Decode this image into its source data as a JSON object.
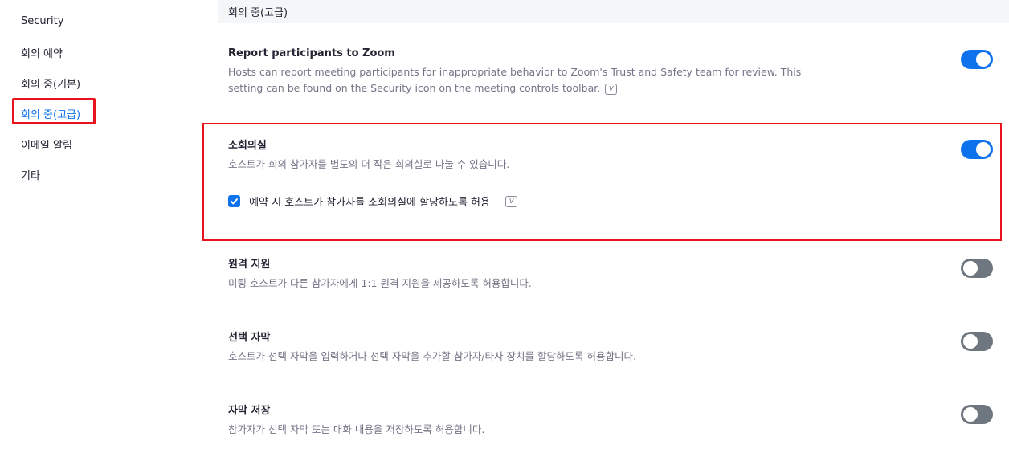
{
  "sidebar": {
    "items": [
      {
        "label": "Security"
      },
      {
        "label": "회의 예약"
      },
      {
        "label": "회의 중(기본)"
      },
      {
        "label": "회의 중(고급)"
      },
      {
        "label": "이메일 알림"
      },
      {
        "label": "기타"
      }
    ],
    "active_index": 3
  },
  "section": {
    "title": "회의 중(고급)"
  },
  "settings": [
    {
      "title": "Report participants to Zoom",
      "description": "Hosts can report meeting participants for inappropriate behavior to Zoom's Trust and Safety team for review. This setting can be found on the Security icon on the meeting controls toolbar.",
      "enabled": true
    },
    {
      "title": "소회의실",
      "description": "호스트가 회의 참가자를 별도의 더 작은 회의실로 나눌 수 있습니다.",
      "enabled": true,
      "checkbox": {
        "label": "예약 시 호스트가 참가자를 소회의실에 할당하도록 허용",
        "checked": true
      }
    },
    {
      "title": "원격 지원",
      "description": "미팅 호스트가 다른 참가자에게 1:1 원격 지원을 제공하도록 허용합니다.",
      "enabled": false
    },
    {
      "title": "선택 자막",
      "description": "호스트가 선택 자막을 입력하거나 선택 자막을 추가할 참가자/타사 장치를 할당하도록 허용합니다.",
      "enabled": false
    },
    {
      "title": "자막 저장",
      "description": "참가자가 선택 자막 또는 대화 내용을 저장하도록 허용합니다.",
      "enabled": false
    }
  ],
  "colors": {
    "accent": "#0e72ed",
    "highlight": "#e8131d",
    "toggle_off": "#6e7680"
  }
}
